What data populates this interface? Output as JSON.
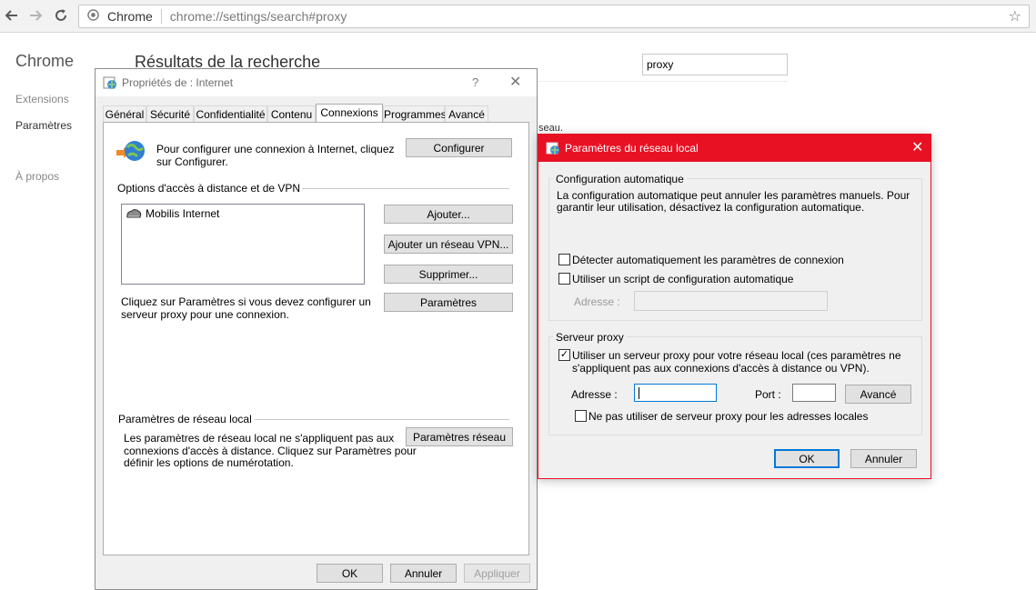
{
  "browser": {
    "brand": "Chrome",
    "url": "chrome://settings/search#proxy"
  },
  "settings": {
    "sidebar_title": "Chrome",
    "sidebar_items": [
      "Extensions",
      "Paramètres",
      "À propos"
    ],
    "page_heading": "Résultats de la recherche",
    "search_value": "proxy",
    "snippet": "seau."
  },
  "internet_properties": {
    "title": "Propriétés de : Internet",
    "help": "?",
    "tabs": [
      "Général",
      "Sécurité",
      "Confidentialité",
      "Contenu",
      "Connexions",
      "Programmes",
      "Avancé"
    ],
    "active_tab": "Connexions",
    "setup_text_1": "Pour configurer une connexion à Internet, cliquez",
    "setup_text_2": "sur Configurer.",
    "configure_button": "Configurer",
    "dialup_heading": "Options d'accès à distance et de VPN",
    "connections": [
      "Mobilis Internet"
    ],
    "add_button": "Ajouter...",
    "add_vpn_button": "Ajouter un réseau VPN...",
    "remove_button": "Supprimer...",
    "settings_button": "Paramètres",
    "proxy_hint_1": "Cliquez sur Paramètres si vous devez configurer un",
    "proxy_hint_2": "serveur proxy pour une connexion.",
    "lan_heading": "Paramètres de réseau local",
    "lan_text_1": "Les paramètres de réseau local ne s'appliquent pas aux",
    "lan_text_2": "connexions d'accès à distance. Cliquez sur Paramètres pour",
    "lan_text_3": "définir les options de numérotation.",
    "lan_button": "Paramètres réseau",
    "ok": "OK",
    "cancel": "Annuler",
    "apply": "Appliquer"
  },
  "lan_settings": {
    "title": "Paramètres du réseau local",
    "auto_config_legend": "Configuration automatique",
    "auto_config_desc_1": "La configuration automatique peut annuler les paramètres manuels. Pour",
    "auto_config_desc_2": "garantir leur utilisation, désactivez la configuration automatique.",
    "auto_detect_label": "Détecter automatiquement les paramètres de connexion",
    "auto_detect_checked": false,
    "use_script_label": "Utiliser un script de configuration automatique",
    "use_script_checked": false,
    "script_address_label": "Adresse :",
    "script_address_value": "",
    "proxy_legend": "Serveur proxy",
    "use_proxy_label_1": "Utiliser un serveur proxy pour votre réseau local (ces paramètres ne",
    "use_proxy_label_2": "s'appliquent pas aux connexions d'accès à distance ou VPN).",
    "use_proxy_checked": true,
    "proxy_address_label": "Adresse :",
    "proxy_address_value": "",
    "port_label": "Port :",
    "port_value": "",
    "advanced_button": "Avancé",
    "bypass_label": "Ne pas utiliser de serveur proxy pour les adresses locales",
    "bypass_checked": false,
    "ok": "OK",
    "cancel": "Annuler",
    "check_glyph": "✓"
  },
  "colors": {
    "lan_title_bar": "#e81123",
    "primary_button_border": "#0078d7"
  }
}
